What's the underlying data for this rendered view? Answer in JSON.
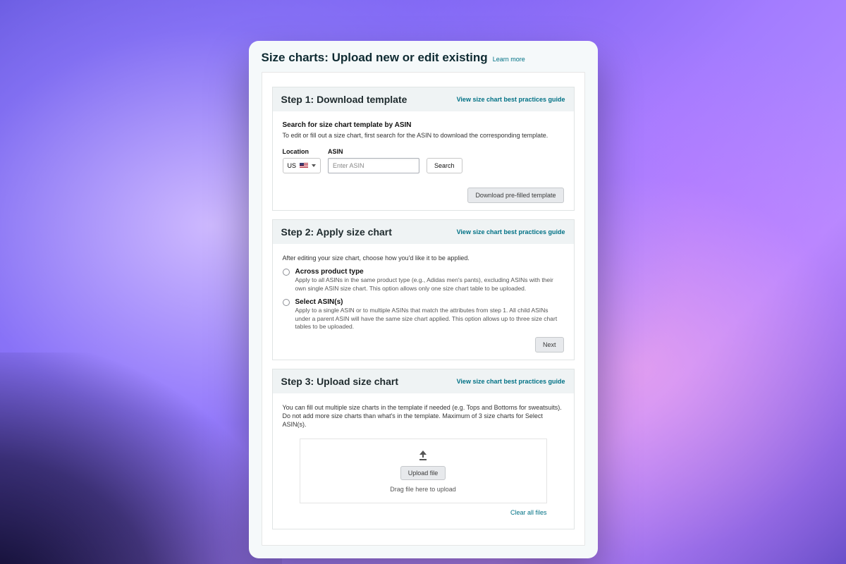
{
  "page": {
    "title": "Size charts: Upload new or edit existing",
    "learn_more": "Learn more"
  },
  "best_practices_link": "View size chart best practices guide",
  "step1": {
    "title": "Step 1: Download template",
    "search_heading": "Search for size chart template by ASIN",
    "search_sub": "To edit or fill out a size chart, first search for the ASIN to download the corresponding template.",
    "location_label": "Location",
    "location_value": "US",
    "asin_label": "ASIN",
    "asin_placeholder": "Enter ASIN",
    "search_btn": "Search",
    "download_btn": "Download pre-filled template"
  },
  "step2": {
    "title": "Step 2: Apply size chart",
    "intro": "After editing your size chart, choose how you'd like it to be applied.",
    "options": [
      {
        "label": "Across product type",
        "desc": "Apply to all ASINs in the same product type (e.g., Adidas men's pants), excluding ASINs with their own single ASIN size chart. This option allows only one size chart table to be uploaded."
      },
      {
        "label": "Select ASIN(s)",
        "desc": "Apply to a single ASIN or to multiple ASINs that match the attributes from step 1. All child ASINs under a parent ASIN will have the same size chart applied. This option allows up to three size chart tables to be uploaded."
      }
    ],
    "next_btn": "Next"
  },
  "step3": {
    "title": "Step 3: Upload size chart",
    "intro": "You can fill out multiple size charts in the template if needed (e.g. Tops and Bottoms for sweatsuits). Do not add more size charts than what's in the template. Maximum of 3 size charts for Select ASIN(s).",
    "upload_btn": "Upload file",
    "drag_text": "Drag file here to upload",
    "clear_link": "Clear all files"
  }
}
